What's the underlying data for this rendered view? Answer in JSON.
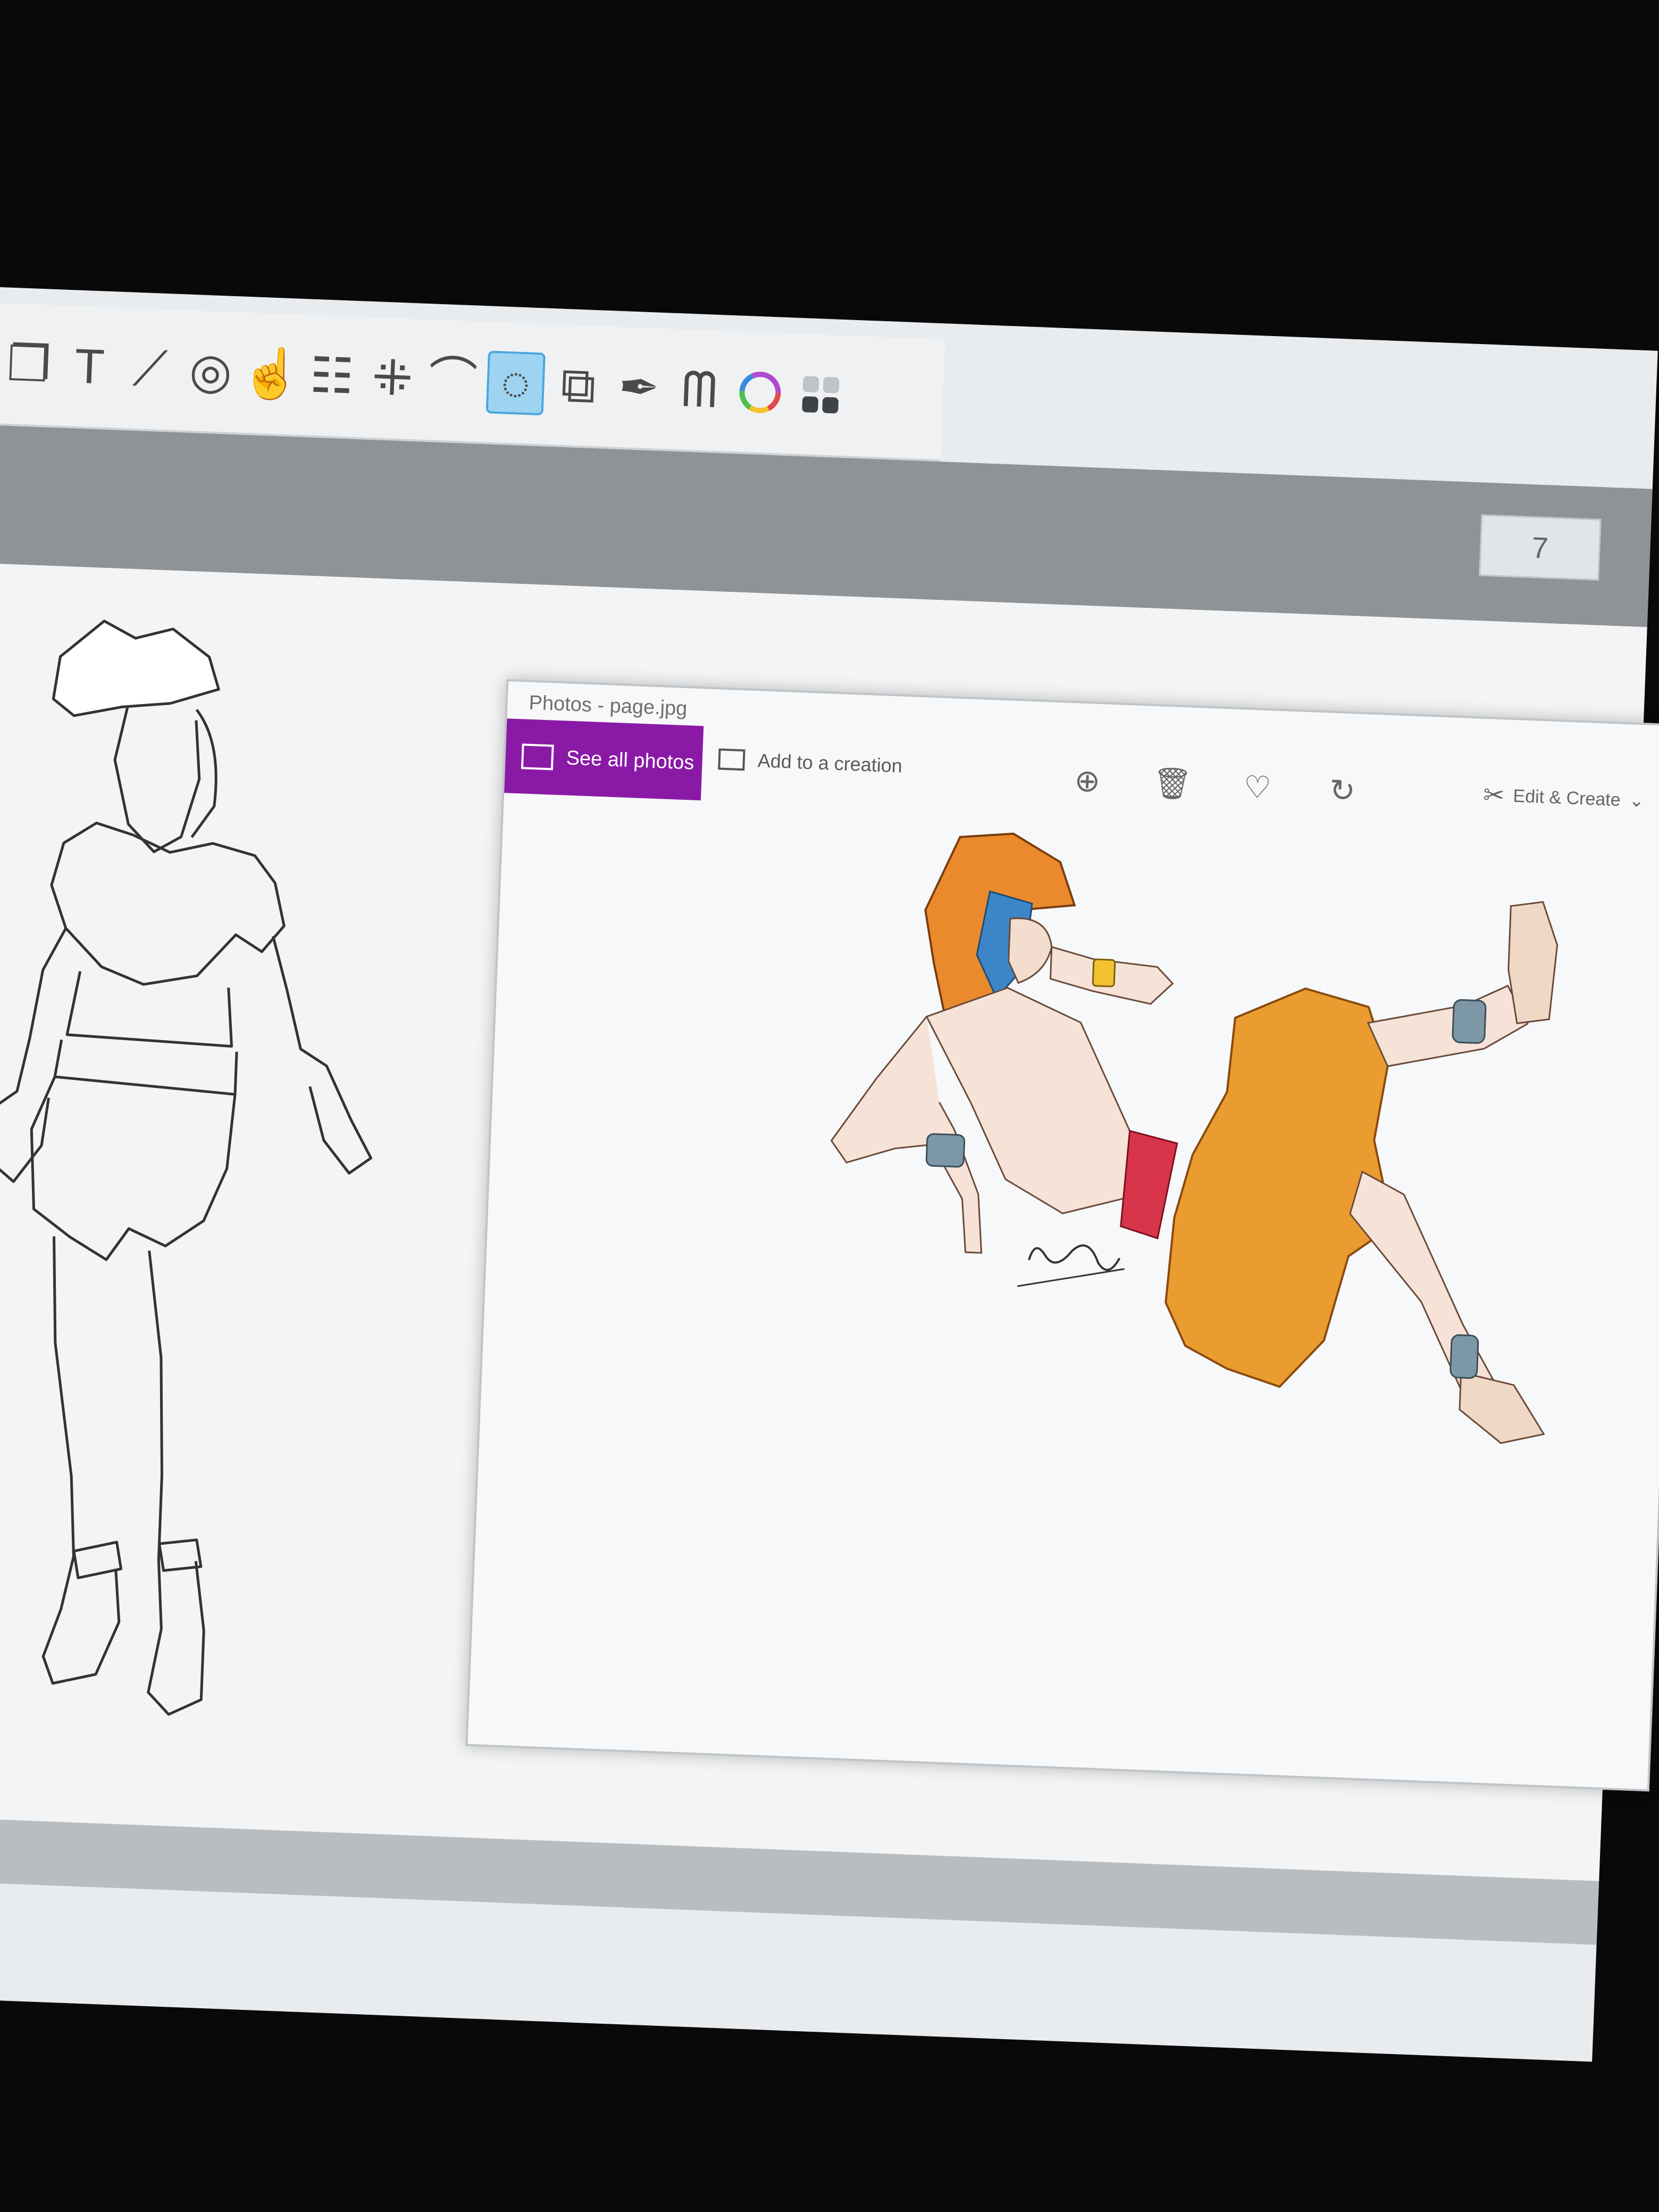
{
  "toolbar": {
    "tools": [
      {
        "icon": "transform-icon",
        "glyph": "❐"
      },
      {
        "icon": "text-icon",
        "glyph": "T"
      },
      {
        "icon": "ruler-icon",
        "glyph": "⟋"
      },
      {
        "icon": "pattern-icon",
        "glyph": "◎"
      },
      {
        "icon": "smudge-icon",
        "glyph": "☝"
      },
      {
        "icon": "fill-icon",
        "glyph": "☷"
      },
      {
        "icon": "selection-icon",
        "glyph": "⁜"
      },
      {
        "icon": "curve-icon",
        "glyph": "⌒"
      },
      {
        "icon": "lasso-icon",
        "glyph": "◌"
      },
      {
        "icon": "layers-icon",
        "glyph": "⧉"
      },
      {
        "icon": "eyedropper-icon",
        "glyph": "✒"
      },
      {
        "icon": "brush-icon",
        "glyph": "ᗰ"
      },
      {
        "icon": "color-wheel-icon",
        "glyph": "◯"
      },
      {
        "icon": "swatches-icon",
        "glyph": "▦"
      }
    ],
    "active_tool": "lasso-icon"
  },
  "zoom": {
    "value": "7"
  },
  "photos": {
    "title": "Photos - page.jpg",
    "see_all_label": "See all photos",
    "add_creation_label": "Add to a creation",
    "edit_create_label": "Edit & Create",
    "accent": "#8a1aa6"
  },
  "artwork": {
    "signature": "Baker Azul"
  }
}
